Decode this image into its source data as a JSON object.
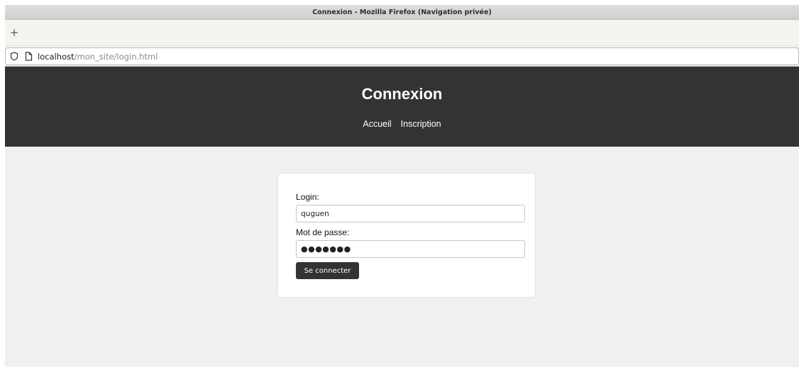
{
  "window": {
    "title": "Connexion - Mozilla Firefox (Navigation privée)"
  },
  "tabstrip": {
    "new_tab_label": "+"
  },
  "urlbar": {
    "host": "localhost",
    "path": "/mon_site/login.html"
  },
  "header": {
    "title": "Connexion",
    "nav": [
      {
        "label": "Accueil"
      },
      {
        "label": "Inscription"
      }
    ]
  },
  "form": {
    "login_label": "Login:",
    "login_value": "quguen",
    "password_label": "Mot de passe:",
    "password_value": "●●●●●●●",
    "submit_label": "Se connecter"
  },
  "colors": {
    "header_bg": "#333333",
    "page_bg": "#f0f0f0",
    "button_bg": "#333333"
  }
}
